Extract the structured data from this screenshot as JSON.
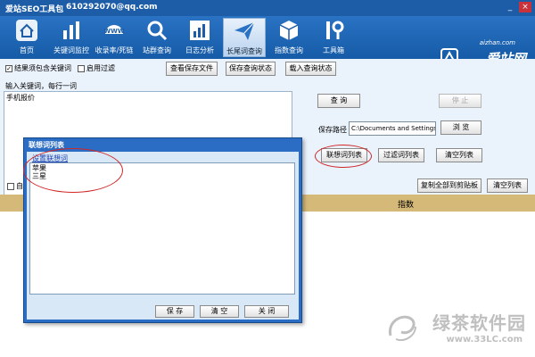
{
  "window": {
    "title": "爱站SEO工具包",
    "account": "610292070@qq.com"
  },
  "toolbar": {
    "items": [
      {
        "label": "首页",
        "icon": "home-icon"
      },
      {
        "label": "关键词监控",
        "icon": "bar-chart-icon"
      },
      {
        "label": "收录率/死链",
        "icon": "www-icon"
      },
      {
        "label": "站群查询",
        "icon": "search-icon"
      },
      {
        "label": "日志分析",
        "icon": "log-chart-icon"
      },
      {
        "label": "长尾词查询",
        "icon": "paper-plane-icon",
        "active": true
      },
      {
        "label": "指数查询",
        "icon": "cube-icon"
      },
      {
        "label": "工具箱",
        "icon": "tools-icon"
      }
    ],
    "brand_url": "aizhan.com",
    "brand_name": "爱站网"
  },
  "options": {
    "include_all_keywords": {
      "label": "结果须包含关键词",
      "checked": true
    },
    "enable_filter": {
      "label": "启用过滤",
      "checked": false
    },
    "view_saved_files": "查看保存文件",
    "save_query_state": "保存查询状态",
    "load_query_state": "载入查询状态"
  },
  "keyword_input": {
    "label": "输入关键词，每行一词",
    "value": "手机报价"
  },
  "actions": {
    "query": "查 询",
    "stop": "停 止",
    "save_path_label": "保存路径",
    "save_path_value": "C:\\Documents and Settings",
    "browse": "浏 览",
    "related_words_list": "联想词列表",
    "filter_words_list": "过滤词列表",
    "clear_list": "清空列表",
    "copy_all": "复制全部到剪贴板",
    "clear_list_2": "清空列表",
    "auto_label": "自"
  },
  "results": {
    "column": "指数"
  },
  "dialog": {
    "title": "联想词列表",
    "set_link": "设置联想词",
    "words": [
      "苹果",
      "三星"
    ],
    "save": "保 存",
    "clear": "清 空",
    "close": "关 闭"
  },
  "watermark": {
    "brand": "绿茶软件园",
    "url": "www.33LC.com"
  },
  "colors": {
    "toolbar_blue": "#1d5da8",
    "header_strip": "#d5b978",
    "dialog_blue": "#2b6cc4",
    "annotation_red": "#d02828"
  }
}
